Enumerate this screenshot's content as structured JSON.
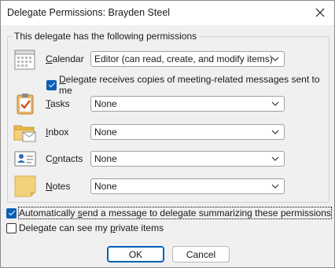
{
  "window": {
    "title": "Delegate Permissions: Brayden Steel"
  },
  "group": {
    "legend": "This delegate has the following permissions"
  },
  "permissions": [
    {
      "label_pre": "",
      "label_acc": "C",
      "label_post": "alendar",
      "value": "Editor (can read, create, and modify items)",
      "icon": "calendar-icon"
    },
    {
      "label_pre": "",
      "label_acc": "T",
      "label_post": "asks",
      "value": "None",
      "icon": "tasks-clipboard-icon"
    },
    {
      "label_pre": "",
      "label_acc": "I",
      "label_post": "nbox",
      "value": "None",
      "icon": "inbox-folder-icon"
    },
    {
      "label_pre": "C",
      "label_acc": "o",
      "label_post": "ntacts",
      "value": "None",
      "icon": "contact-card-icon"
    },
    {
      "label_pre": "",
      "label_acc": "N",
      "label_post": "otes",
      "value": "None",
      "icon": "sticky-note-icon"
    }
  ],
  "meeting_copies": {
    "checked": true,
    "label_pre": "",
    "label_acc": "D",
    "label_post": "elegate receives copies of meeting-related messages sent to me"
  },
  "auto_send": {
    "checked": true,
    "label_pre": "Automatically ",
    "label_acc": "s",
    "label_post": "end a message to delegate summarizing these permissions"
  },
  "private_items": {
    "checked": false,
    "label_pre": "Delegate can see my ",
    "label_acc": "p",
    "label_post": "rivate items"
  },
  "buttons": {
    "ok": "OK",
    "cancel": "Cancel"
  },
  "colors": {
    "accent": "#0a5fb4",
    "dialog_bg": "#f0f0f0"
  }
}
